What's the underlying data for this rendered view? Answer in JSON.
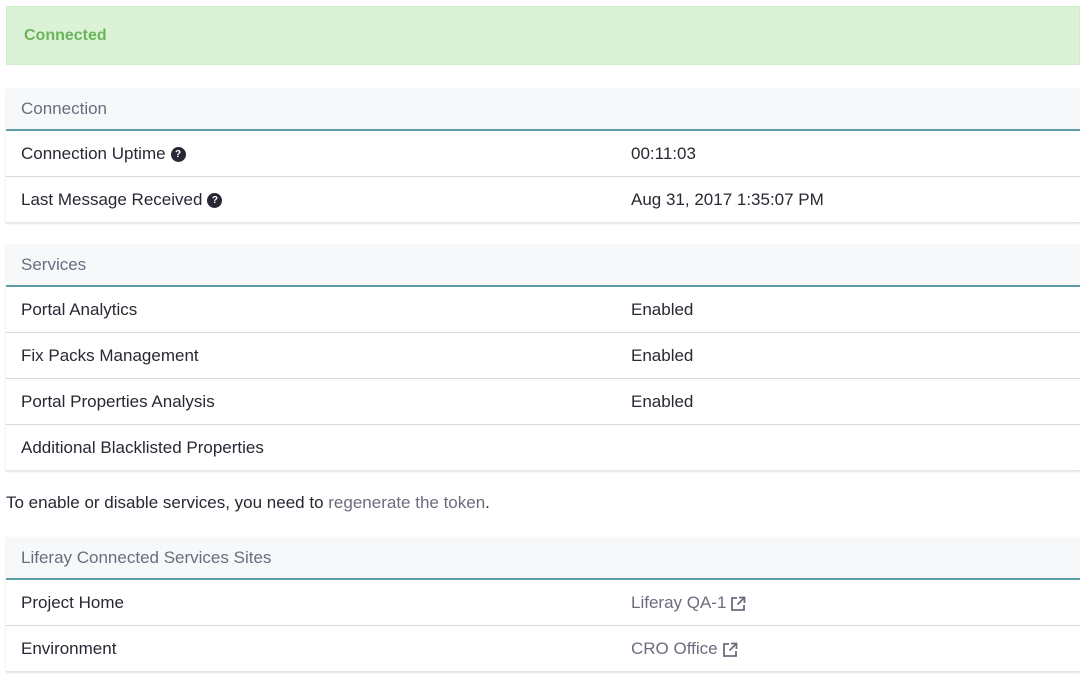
{
  "alert": {
    "text": "Connected"
  },
  "connection": {
    "title": "Connection",
    "rows": [
      {
        "label": "Connection Uptime",
        "value": "00:11:03"
      },
      {
        "label": "Last Message Received",
        "value": "Aug 31, 2017 1:35:07 PM"
      }
    ]
  },
  "services": {
    "title": "Services",
    "rows": [
      {
        "label": "Portal Analytics",
        "value": "Enabled"
      },
      {
        "label": "Fix Packs Management",
        "value": "Enabled"
      },
      {
        "label": "Portal Properties Analysis",
        "value": "Enabled"
      },
      {
        "label": "Additional Blacklisted Properties",
        "value": ""
      }
    ]
  },
  "note": {
    "prefix": "To enable or disable services, you need to ",
    "link": "regenerate the token",
    "suffix": "."
  },
  "sites": {
    "title": "Liferay Connected Services Sites",
    "rows": [
      {
        "label": "Project Home",
        "link": "Liferay QA-1"
      },
      {
        "label": "Environment",
        "link": "CRO Office"
      }
    ]
  },
  "icons": {
    "help": "question-circle-icon",
    "external": "external-link-icon"
  },
  "colors": {
    "success_bg": "#dcf2d6",
    "success_text": "#6ab45c",
    "header_border": "#5d9ea6",
    "link": "#6b6c7e"
  }
}
